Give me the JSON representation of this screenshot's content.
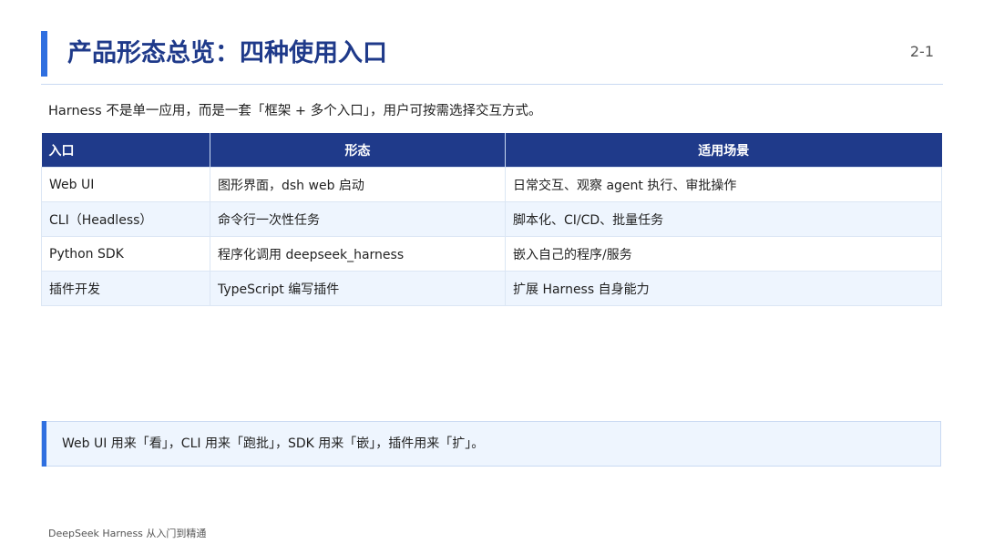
{
  "header": {
    "title": "产品形态总览：四种使用入口",
    "page_number": "2-1"
  },
  "intro": "Harness 不是单一应用，而是一套「框架 + 多个入口」，用户可按需选择交互方式。",
  "table": {
    "columns": [
      "入口",
      "形态",
      "适用场景"
    ],
    "rows": [
      [
        "Web UI",
        "图形界面，dsh web 启动",
        "日常交互、观察 agent 执行、审批操作"
      ],
      [
        "CLI（Headless）",
        "命令行一次性任务",
        "脚本化、CI/CD、批量任务"
      ],
      [
        "Python SDK",
        "程序化调用 deepseek_harness",
        "嵌入自己的程序/服务"
      ],
      [
        "插件开发",
        "TypeScript 编写插件",
        "扩展 Harness 自身能力"
      ]
    ]
  },
  "note": "Web UI 用来「看」，CLI 用来「跑批」，SDK 用来「嵌」，插件用来「扩」。",
  "footer": "DeepSeek Harness 从入门到精通",
  "colors": {
    "accent": "#2f6fe0",
    "header_bg": "#1f3a8a",
    "row_alt": "#eef5fe"
  }
}
